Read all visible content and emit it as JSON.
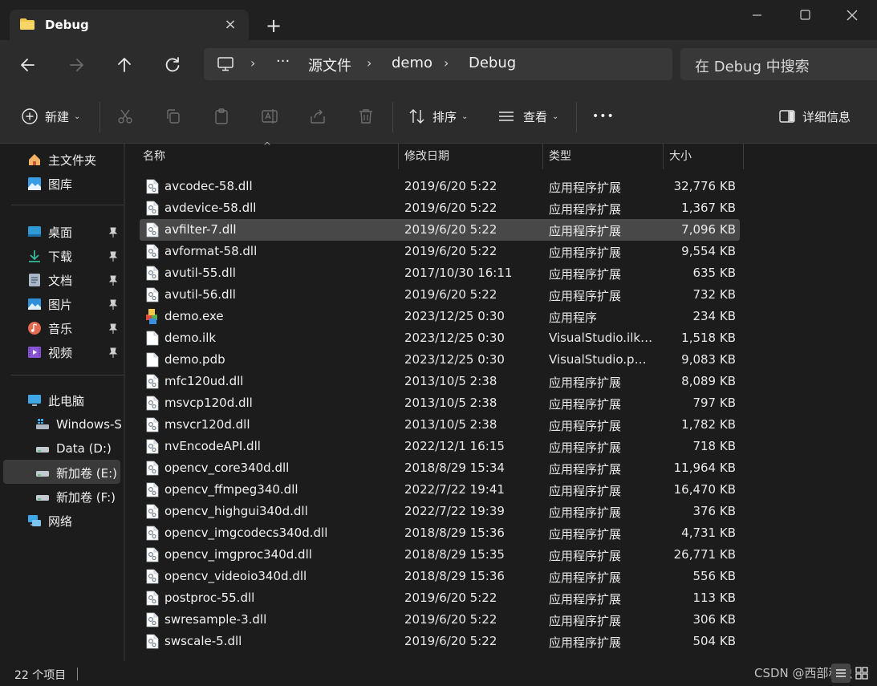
{
  "window": {
    "tab_title": "Debug",
    "tab_close": "×",
    "new_tab": "+"
  },
  "address": {
    "overflow": "···",
    "crumbs": [
      "源文件",
      "demo",
      "Debug"
    ],
    "search_placeholder": "在 Debug 中搜索"
  },
  "commands": {
    "new_label": "新建",
    "sort_label": "排序",
    "view_label": "查看",
    "more_label": "•••",
    "details_label": "详细信息"
  },
  "sidebar": {
    "quick": [
      {
        "label": "主文件夹",
        "icon": "home-icon"
      },
      {
        "label": "图库",
        "icon": "gallery-icon"
      }
    ],
    "pinned": [
      {
        "label": "桌面",
        "icon": "desktop-icon"
      },
      {
        "label": "下载",
        "icon": "download-icon"
      },
      {
        "label": "文档",
        "icon": "document-icon"
      },
      {
        "label": "图片",
        "icon": "pictures-icon"
      },
      {
        "label": "音乐",
        "icon": "music-icon"
      },
      {
        "label": "视频",
        "icon": "video-icon"
      }
    ],
    "this_pc": "此电脑",
    "drives": [
      {
        "label": "Windows-S",
        "icon": "system-drive-icon"
      },
      {
        "label": "Data (D:)",
        "icon": "drive-icon"
      },
      {
        "label": "新加卷 (E:)",
        "icon": "drive-icon"
      },
      {
        "label": "新加卷 (F:)",
        "icon": "drive-icon"
      }
    ],
    "network": "网络",
    "selected_drive": "新加卷 (E:)"
  },
  "columns": {
    "name": "名称",
    "date": "修改日期",
    "type": "类型",
    "size": "大小"
  },
  "files": [
    {
      "name": "avcodec-58.dll",
      "date": "2019/6/20 5:22",
      "type": "应用程序扩展",
      "size": "32,776 KB",
      "icon": "dll-icon"
    },
    {
      "name": "avdevice-58.dll",
      "date": "2019/6/20 5:22",
      "type": "应用程序扩展",
      "size": "1,367 KB",
      "icon": "dll-icon"
    },
    {
      "name": "avfilter-7.dll",
      "date": "2019/6/20 5:22",
      "type": "应用程序扩展",
      "size": "7,096 KB",
      "icon": "dll-icon"
    },
    {
      "name": "avformat-58.dll",
      "date": "2019/6/20 5:22",
      "type": "应用程序扩展",
      "size": "9,554 KB",
      "icon": "dll-icon"
    },
    {
      "name": "avutil-55.dll",
      "date": "2017/10/30 16:11",
      "type": "应用程序扩展",
      "size": "635 KB",
      "icon": "dll-icon"
    },
    {
      "name": "avutil-56.dll",
      "date": "2019/6/20 5:22",
      "type": "应用程序扩展",
      "size": "732 KB",
      "icon": "dll-icon"
    },
    {
      "name": "demo.exe",
      "date": "2023/12/25 0:30",
      "type": "应用程序",
      "size": "234 KB",
      "icon": "exe-icon"
    },
    {
      "name": "demo.ilk",
      "date": "2023/12/25 0:30",
      "type": "VisualStudio.ilk....",
      "size": "1,518 KB",
      "icon": "blank-file-icon"
    },
    {
      "name": "demo.pdb",
      "date": "2023/12/25 0:30",
      "type": "VisualStudio.pd...",
      "size": "9,083 KB",
      "icon": "blank-file-icon"
    },
    {
      "name": "mfc120ud.dll",
      "date": "2013/10/5 2:38",
      "type": "应用程序扩展",
      "size": "8,089 KB",
      "icon": "dll-icon"
    },
    {
      "name": "msvcp120d.dll",
      "date": "2013/10/5 2:38",
      "type": "应用程序扩展",
      "size": "797 KB",
      "icon": "dll-icon"
    },
    {
      "name": "msvcr120d.dll",
      "date": "2013/10/5 2:38",
      "type": "应用程序扩展",
      "size": "1,782 KB",
      "icon": "dll-icon"
    },
    {
      "name": "nvEncodeAPI.dll",
      "date": "2022/12/1 16:15",
      "type": "应用程序扩展",
      "size": "718 KB",
      "icon": "dll-icon"
    },
    {
      "name": "opencv_core340d.dll",
      "date": "2018/8/29 15:34",
      "type": "应用程序扩展",
      "size": "11,964 KB",
      "icon": "dll-icon"
    },
    {
      "name": "opencv_ffmpeg340.dll",
      "date": "2022/7/22 19:41",
      "type": "应用程序扩展",
      "size": "16,470 KB",
      "icon": "dll-icon"
    },
    {
      "name": "opencv_highgui340d.dll",
      "date": "2022/7/22 19:39",
      "type": "应用程序扩展",
      "size": "376 KB",
      "icon": "dll-icon"
    },
    {
      "name": "opencv_imgcodecs340d.dll",
      "date": "2018/8/29 15:36",
      "type": "应用程序扩展",
      "size": "4,731 KB",
      "icon": "dll-icon"
    },
    {
      "name": "opencv_imgproc340d.dll",
      "date": "2018/8/29 15:35",
      "type": "应用程序扩展",
      "size": "26,771 KB",
      "icon": "dll-icon"
    },
    {
      "name": "opencv_videoio340d.dll",
      "date": "2018/8/29 15:36",
      "type": "应用程序扩展",
      "size": "556 KB",
      "icon": "dll-icon"
    },
    {
      "name": "postproc-55.dll",
      "date": "2019/6/20 5:22",
      "type": "应用程序扩展",
      "size": "113 KB",
      "icon": "dll-icon"
    },
    {
      "name": "swresample-3.dll",
      "date": "2019/6/20 5:22",
      "type": "应用程序扩展",
      "size": "306 KB",
      "icon": "dll-icon"
    },
    {
      "name": "swscale-5.dll",
      "date": "2019/6/20 5:22",
      "type": "应用程序扩展",
      "size": "504 KB",
      "icon": "dll-icon"
    }
  ],
  "selected_file": "avfilter-7.dll",
  "status": {
    "item_count": "22 个项目",
    "watermark": "CSDN @西部秋虫"
  },
  "colors": {
    "background": "#1c1c1c",
    "chrome": "#2c2c2c",
    "selection": "#484848",
    "folder_yellow": "#f2c84b",
    "accent_blue": "#4cc2ff"
  }
}
